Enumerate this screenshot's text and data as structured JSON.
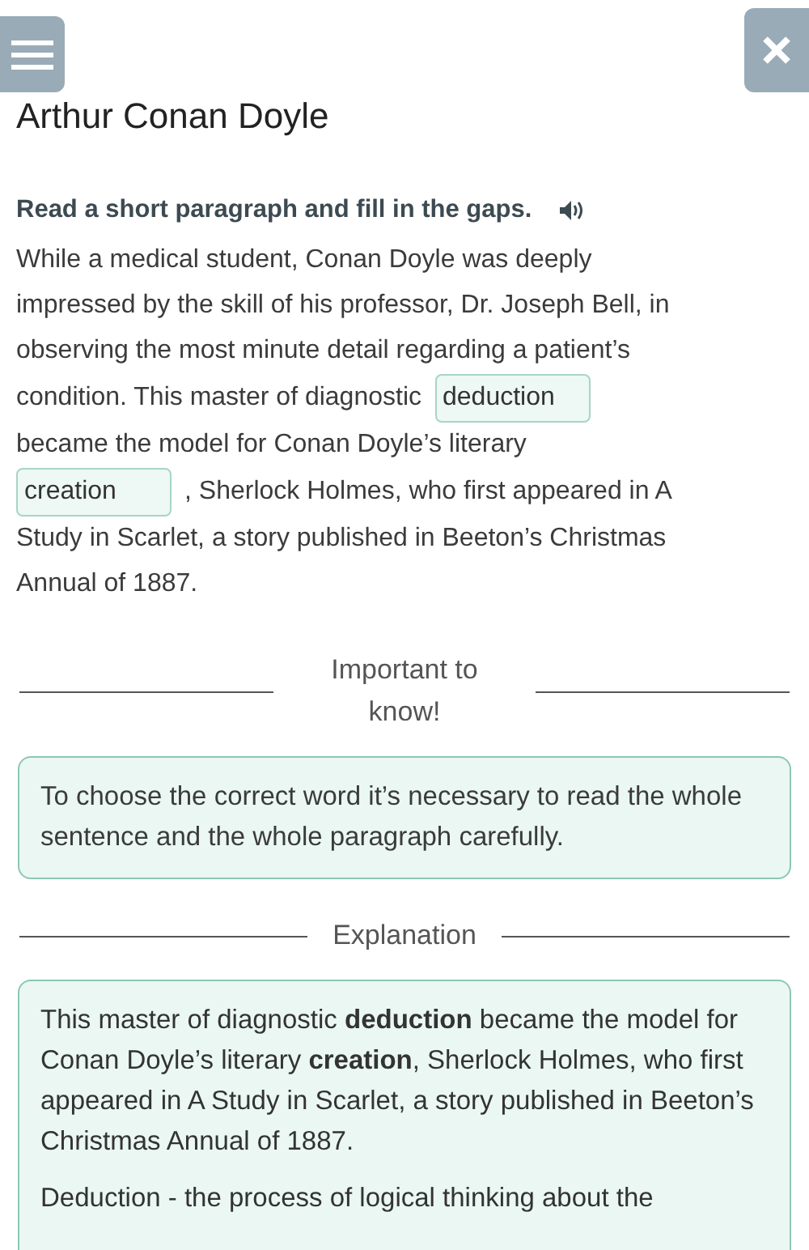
{
  "header": {
    "title": "Arthur Conan Doyle"
  },
  "task": {
    "instruction": "Read a short paragraph and fill in the gaps.",
    "lines": [
      [
        {
          "kind": "text",
          "text": "While a medical student, Conan Doyle was deeply"
        }
      ],
      [
        {
          "kind": "text",
          "text": "impressed by the skill of his professor, Dr. Joseph Bell, in"
        }
      ],
      [
        {
          "kind": "text",
          "text": "observing the most minute detail regarding a patient’s"
        }
      ],
      [
        {
          "kind": "text",
          "text": "condition. This master of diagnostic"
        },
        {
          "kind": "gap",
          "value": "deduction"
        }
      ],
      [
        {
          "kind": "text",
          "text": "became the model for Conan Doyle’s literary"
        }
      ],
      [
        {
          "kind": "gap",
          "value": "creation"
        },
        {
          "kind": "text",
          "text": ", Sherlock Holmes, who first appeared in A"
        }
      ],
      [
        {
          "kind": "text",
          "text": "Study in Scarlet, a story published in Beeton’s Christmas"
        }
      ],
      [
        {
          "kind": "text",
          "text": "Annual of 1887."
        }
      ]
    ]
  },
  "important": {
    "heading": "Important to know!",
    "text": "To choose the correct word it’s necessary to read the whole sentence and the whole paragraph carefully."
  },
  "explanation": {
    "heading": "Explanation",
    "paragraphs": [
      "This master of diagnostic **deduction** became the model for Conan Doyle’s literary **creation**, Sherlock Holmes, who first appeared in A Study in Scarlet, a story published in Beeton’s Christmas Annual of 1887.",
      "Deduction - the process of logical thinking about the"
    ]
  }
}
